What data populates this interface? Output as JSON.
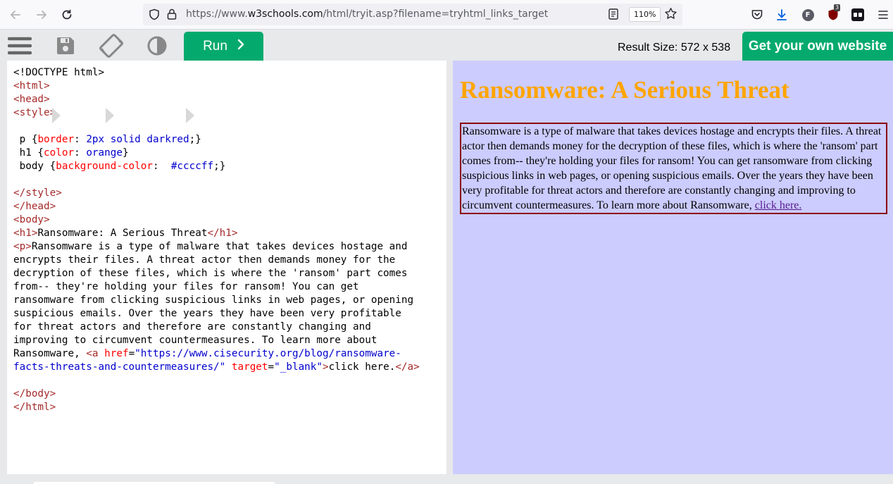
{
  "browser": {
    "url_prefix": "https://www.",
    "url_host": "w3schools.com",
    "url_path": "/html/tryit.asp?filename=tryhtml_links_target",
    "zoom": "110%",
    "extension_badge": "3",
    "profile_letter": "F"
  },
  "toolbar": {
    "run_label": "Run",
    "result_size": "Result Size: 572 x 538",
    "get_website_label": "Get your own website"
  },
  "code_lines": [
    [
      [
        "p",
        "<!DOCTYPE html>"
      ]
    ],
    [
      [
        "t",
        "<html>"
      ]
    ],
    [
      [
        "t",
        "<head>"
      ]
    ],
    [
      [
        "t",
        "<style>"
      ]
    ],
    [],
    [
      [
        "p",
        " p {"
      ],
      [
        "a",
        "border"
      ],
      [
        "p",
        ": "
      ],
      [
        "v",
        "2px solid darkred"
      ],
      [
        "p",
        ";}"
      ]
    ],
    [
      [
        "p",
        " h1 {"
      ],
      [
        "a",
        "color"
      ],
      [
        "p",
        ": "
      ],
      [
        "v",
        "orange"
      ],
      [
        "p",
        "}"
      ]
    ],
    [
      [
        "p",
        " body {"
      ],
      [
        "a",
        "background-color"
      ],
      [
        "p",
        ":  "
      ],
      [
        "v",
        "#ccccff"
      ],
      [
        "p",
        ";}"
      ]
    ],
    [],
    [
      [
        "t",
        "</style>"
      ]
    ],
    [
      [
        "t",
        "</head>"
      ]
    ],
    [
      [
        "t",
        "<body>"
      ]
    ],
    [
      [
        "t",
        "<h1>"
      ],
      [
        "p",
        "Ransomware: A Serious Threat"
      ],
      [
        "t",
        "</h1>"
      ]
    ],
    [
      [
        "t",
        "<p>"
      ],
      [
        "p",
        "Ransomware is a type of malware that takes devices hostage and"
      ]
    ],
    [
      [
        "p",
        "encrypts their files. A threat actor then demands money for the"
      ]
    ],
    [
      [
        "p",
        "decryption of these files, which is where the 'ransom' part comes"
      ]
    ],
    [
      [
        "p",
        "from-- they're holding your files for ransom! You can get"
      ]
    ],
    [
      [
        "p",
        "ransomware from clicking suspicious links in web pages, or opening"
      ]
    ],
    [
      [
        "p",
        "suspicious emails. Over the years they have been very profitable"
      ]
    ],
    [
      [
        "p",
        "for threat actors and therefore are constantly changing and"
      ]
    ],
    [
      [
        "p",
        "improving to circumvent countermeasures. To learn more about"
      ]
    ],
    [
      [
        "p",
        "Ransomware, "
      ],
      [
        "t",
        "<a "
      ],
      [
        "a",
        "href"
      ],
      [
        "p",
        "="
      ],
      [
        "b",
        "\"https://www.cisecurity.org/blog/ransomware-"
      ]
    ],
    [
      [
        "b",
        "facts-threats-and-countermeasures/\""
      ],
      [
        "p",
        " "
      ],
      [
        "a",
        "target"
      ],
      [
        "p",
        "="
      ],
      [
        "b",
        "\"_blank\""
      ],
      [
        "t",
        ">"
      ],
      [
        "p",
        "click here."
      ],
      [
        "t",
        "</a>"
      ]
    ],
    [],
    [
      [
        "t",
        "</body>"
      ]
    ],
    [
      [
        "t",
        "</html>"
      ]
    ]
  ],
  "result": {
    "heading": "Ransomware: A Serious Threat",
    "paragraph": "Ransomware is a type of malware that takes devices hostage and encrypts their files. A threat actor then demands money for the decryption of these files, which is where the 'ransom' part comes from-- they're holding your files for ransom! You can get ransomware from clicking suspicious links in web pages, or opening suspicious emails. Over the years they have been very profitable for threat actors and therefore are constantly changing and improving to circumvent countermeasures. To learn more about Ransomware,",
    "link_text": "click here."
  },
  "colors": {
    "run_green": "#04aa6d",
    "result_bg": "#ccccff",
    "heading_orange": "orange",
    "border_darkred": "darkred",
    "tag_color": "#a52a2a",
    "attr_color": "#ff0000",
    "value_color": "#0000cd"
  },
  "icons": [
    "back-arrow-icon",
    "forward-arrow-icon",
    "reload-icon",
    "shield-icon",
    "lock-icon",
    "reader-view-icon",
    "bookmark-star-icon",
    "pocket-icon",
    "download-icon",
    "profile-icon",
    "ublock-icon",
    "extension-icon",
    "menu-icon",
    "hamburger-icon",
    "save-icon",
    "rotate-icon",
    "contrast-icon",
    "chevron-right-icon"
  ]
}
